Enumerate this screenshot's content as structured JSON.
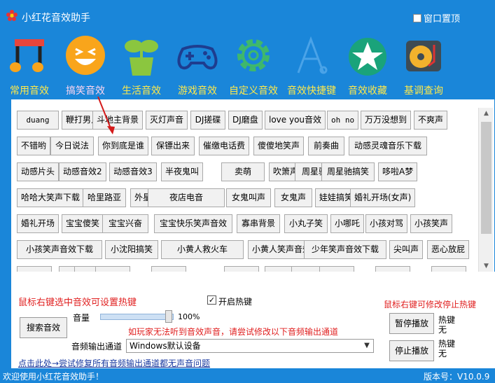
{
  "window": {
    "title": "小红花音效助手",
    "topmost_label": "窗口置顶",
    "minimize": "—",
    "close": "✕"
  },
  "ribbon": [
    {
      "label": "常用音效",
      "icon": "music-note-icon"
    },
    {
      "label": "搞笑音效",
      "icon": "laughing-face-icon"
    },
    {
      "label": "生活音效",
      "icon": "plant-pot-icon"
    },
    {
      "label": "游戏音效",
      "icon": "gamepad-icon"
    },
    {
      "label": "自定义音效",
      "icon": "gear-icon"
    },
    {
      "label": "音效快捷键",
      "icon": "hotkey-icon"
    },
    {
      "label": "音效收藏",
      "icon": "star-icon"
    },
    {
      "label": "基调查询",
      "icon": "turntable-icon"
    }
  ],
  "sound_buttons": [
    [
      "duang",
      "鞭打男人",
      "斗地主背景",
      "灭灯声音",
      "DJ搓碟",
      "DJ磨盘",
      "love you音效",
      "oh no",
      "万万没想到",
      "不爽声"
    ],
    [
      "不错哟",
      "今日说法",
      "你到底是谁",
      "保镖出来",
      "催缴电话费",
      "傻傻地笑声",
      "前奏曲",
      "动感灵魂音乐下载"
    ],
    [
      "动感片头",
      "动感音效2",
      "动感音效3",
      "半夜鬼叫",
      "卖萌",
      "吹箫声",
      "周星驰对白",
      "周星驰搞笑",
      "哆啦A梦"
    ],
    [
      "哈哈大笑声下载",
      "哈里路亚",
      "外星人笑声声下载",
      "夜店电音",
      "女鬼叫声",
      "女鬼声",
      "娃娃搞笑",
      "婚礼开场(女声)"
    ],
    [
      "婚礼开场",
      "宝宝傻笑",
      "宝宝兴奋",
      "宝宝快乐笑声音效",
      "寡串背景",
      "小丸子笑",
      "小哪吒",
      "小孩对骂",
      "小孩笑声"
    ],
    [
      "小孩笑声音效下载",
      "小沈阳搞笑",
      "小黄人救火车",
      "小黄人笑声音效",
      "少年笑声音效下载",
      "尖叫声",
      "恶心放屁"
    ]
  ],
  "bottom": {
    "hotkey_hint": "鼠标右键选中音效可设置热键",
    "enable_hotkey": "开启热键",
    "volume_label": "音量",
    "volume_value": "100%",
    "volume_level": 1.0,
    "search_button": "搜索音效",
    "warning": "如玩家无法听到音效声音，请尝试修改以下音频输出通道",
    "output_label": "音频输出通道",
    "output_value": "Windows默认设备",
    "stop_hint": "鼠标右键可修改停止热键",
    "pause_button": "暂停播放",
    "stop_button": "停止播放",
    "hotkey_word": "热键",
    "hotkey_none": "无",
    "repair_link": "点击此处→尝试修复所有音频输出通道都无声音问题"
  },
  "status": {
    "welcome": "欢迎使用小红花音效助手！",
    "version": "版本号：V10.0.9"
  },
  "colors": {
    "chrome": "#1a86d9",
    "ribbon_label": "#ffe94a",
    "hint_red": "#e02020"
  }
}
